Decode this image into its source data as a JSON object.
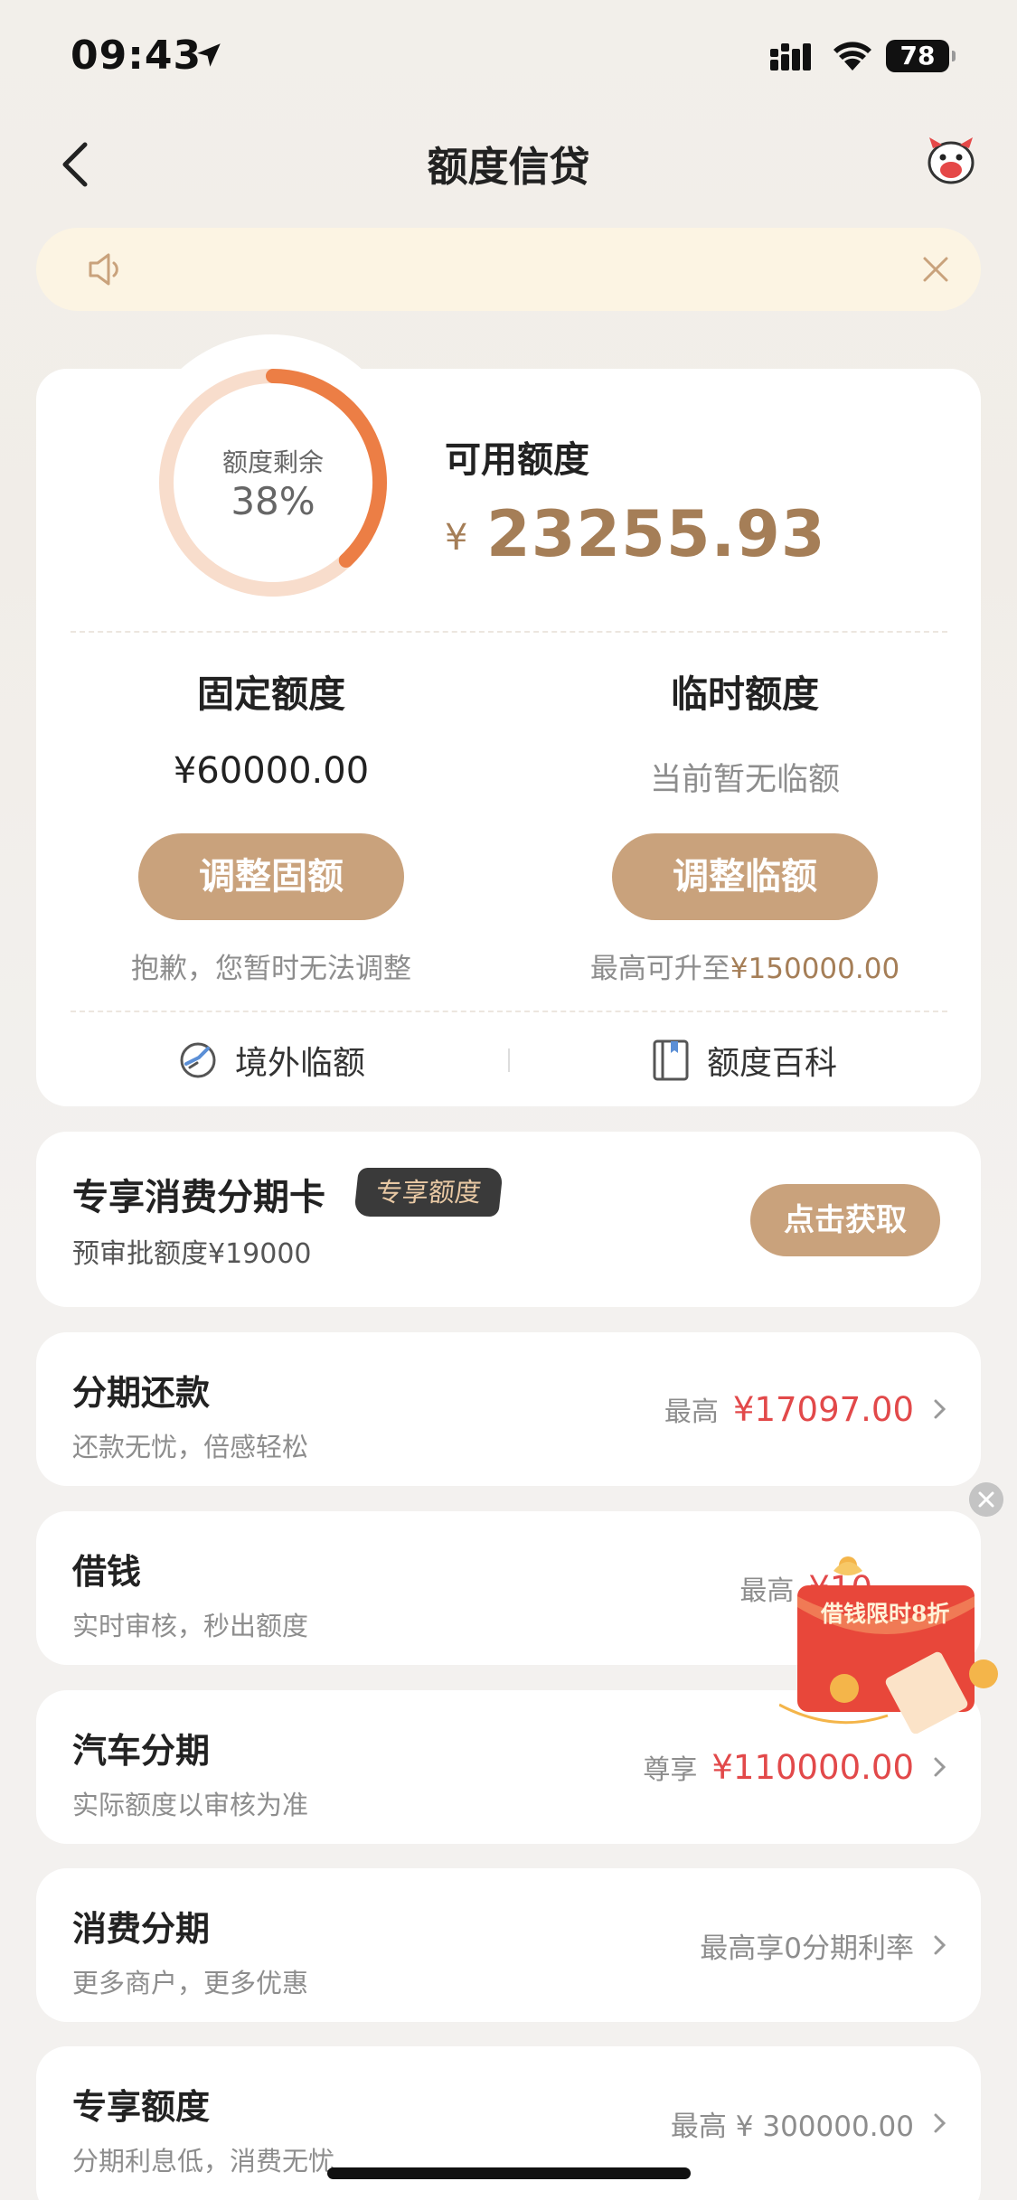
{
  "status_bar": {
    "time": "09:43",
    "battery": "78"
  },
  "nav": {
    "title": "额度信贷"
  },
  "summary": {
    "ring_label": "额度剩余",
    "ring_value": "38%",
    "ring_fraction": 0.38,
    "available_label": "可用额度",
    "available_currency": "¥",
    "available_value": "23255.93"
  },
  "fixed": {
    "title": "固定额度",
    "value": "¥60000.00",
    "button": "调整固额",
    "note": "抱歉，您暂时无法调整"
  },
  "temporary": {
    "title": "临时额度",
    "status": "当前暂无临额",
    "button": "调整临额",
    "note_prefix": "最高可升至",
    "note_amount": "¥150000.00"
  },
  "links": {
    "overseas": "境外临额",
    "wiki": "额度百科"
  },
  "promo": {
    "title": "专享消费分期卡",
    "tag": "专享额度",
    "subtitle": "预审批额度¥19000",
    "button": "点击获取"
  },
  "list": [
    {
      "title": "分期还款",
      "subtitle": "还款无忧，倍感轻松",
      "prefix": "最高",
      "amount": "¥17097.00"
    },
    {
      "title": "借钱",
      "subtitle": "实时审核，秒出额度",
      "prefix": "最高",
      "amount": "¥10"
    },
    {
      "title": "汽车分期",
      "subtitle": "实际额度以审核为准",
      "prefix": "尊享",
      "amount": "¥110000.00"
    },
    {
      "title": "消费分期",
      "subtitle": "更多商户，更多优惠",
      "text": "最高享0分期利率"
    },
    {
      "title": "专享额度",
      "subtitle": "分期利息低，消费无忧",
      "text": "最高 ¥ 300000.00"
    }
  ],
  "coupon": {
    "text": "借钱限时8折"
  },
  "colors": {
    "accent_gold": "#c9a27c",
    "amount_red": "#e2494a",
    "ring_orange": "#ec7e45"
  }
}
